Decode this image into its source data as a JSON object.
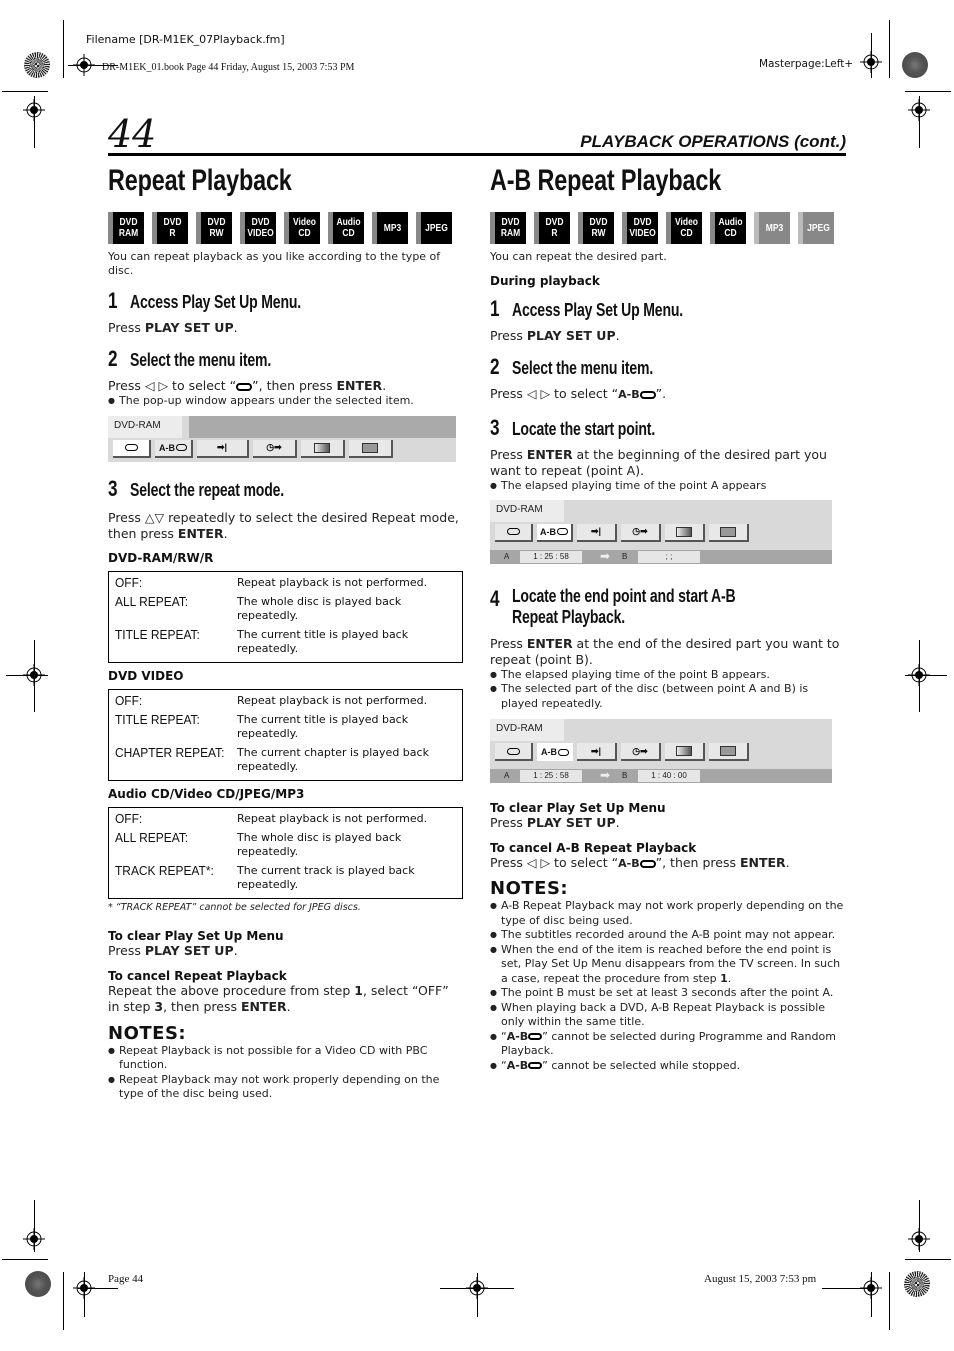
{
  "print_meta": {
    "filename": "Filename [DR-M1EK_07Playback.fm]",
    "book_line": "DR-M1EK_01.book  Page 44  Friday, August 15, 2003  7:53 PM",
    "masterpage": "Masterpage:Left+",
    "footer_page": "Page 44",
    "footer_date": "August 15, 2003 7:53 pm"
  },
  "page": {
    "number": "44",
    "section_header": "PLAYBACK OPERATIONS (cont.)"
  },
  "disc_types": [
    {
      "label": "DVD\nRAM"
    },
    {
      "label": "DVD\nR"
    },
    {
      "label": "DVD\nRW"
    },
    {
      "label": "DVD\nVIDEO"
    },
    {
      "label": "Video\nCD"
    },
    {
      "label": "Audio\nCD"
    },
    {
      "label": "MP3"
    },
    {
      "label": "JPEG"
    }
  ],
  "left": {
    "title": "Repeat Playback",
    "disc_support": [
      true,
      true,
      true,
      true,
      true,
      true,
      true,
      true
    ],
    "intro": "You can repeat playback as you like according to the type of disc.",
    "steps": [
      {
        "num": "1",
        "title": "Access Play Set Up Menu.",
        "text_pre": "Press ",
        "text_bold": "PLAY SET UP",
        "text_post": "."
      },
      {
        "num": "2",
        "title": "Select the menu item.",
        "text_pre": "Press ◁ ▷ to select “",
        "text_mid": "”, then press ",
        "text_bold": "ENTER",
        "text_post": ".",
        "bullet": "The pop-up window appears under the selected item."
      },
      {
        "num": "3",
        "title": "Select the repeat mode.",
        "text_pre": "Press △▽ repeatedly to select the desired Repeat mode, then press ",
        "text_bold": "ENTER",
        "text_post": "."
      }
    ],
    "osd": {
      "tab": "DVD-RAM",
      "ab_label": "A-B"
    },
    "tables": [
      {
        "heading": "DVD-RAM/RW/R",
        "rows": [
          {
            "k": "OFF:",
            "v": "Repeat playback is not performed."
          },
          {
            "k": "ALL REPEAT:",
            "v": "The whole disc is played back repeatedly."
          },
          {
            "k": "TITLE REPEAT:",
            "v": "The current title is played back repeatedly."
          }
        ]
      },
      {
        "heading": "DVD VIDEO",
        "rows": [
          {
            "k": "OFF:",
            "v": "Repeat playback is not performed."
          },
          {
            "k": "TITLE REPEAT:",
            "v": "The current title is played back repeatedly."
          },
          {
            "k": "CHAPTER REPEAT:",
            "v": "The current chapter is played back repeatedly."
          }
        ]
      },
      {
        "heading": "Audio CD/Video CD/JPEG/MP3",
        "rows": [
          {
            "k": "OFF:",
            "v": "Repeat playback is not performed."
          },
          {
            "k": "ALL REPEAT:",
            "v": "The whole disc is played back repeatedly."
          },
          {
            "k": "TRACK REPEAT*:",
            "v": "The current track is played back repeatedly."
          }
        ]
      }
    ],
    "footnote": "*  “TRACK REPEAT” cannot be selected for JPEG discs.",
    "clear": {
      "heading": "To clear Play Set Up Menu",
      "pre": "Press ",
      "bold": "PLAY SET UP",
      "post": "."
    },
    "cancel": {
      "heading": "To cancel Repeat Playback",
      "t1": "Repeat the above procedure from step ",
      "b1": "1",
      "t2": ", select “OFF” in step ",
      "b2": "3",
      "t3": ", then press ",
      "b3": "ENTER",
      "t4": "."
    },
    "notes_heading": "NOTES:",
    "notes": [
      "Repeat Playback is not possible for a Video CD with PBC function.",
      "Repeat Playback may not work properly depending on the type of the disc being used."
    ]
  },
  "right": {
    "title": "A-B Repeat Playback",
    "disc_support": [
      true,
      true,
      true,
      true,
      true,
      true,
      false,
      false
    ],
    "intro": "You can repeat the desired part.",
    "during": "During playback",
    "steps": [
      {
        "num": "1",
        "title": "Access Play Set Up Menu.",
        "text_pre": "Press ",
        "text_bold": "PLAY SET UP",
        "text_post": "."
      },
      {
        "num": "2",
        "title": "Select the menu item.",
        "text_pre": "Press ◁ ▷ to select “",
        "text_post": "”."
      },
      {
        "num": "3",
        "title": "Locate the start point.",
        "text_pre": "Press ",
        "text_bold": "ENTER",
        "text_post": " at the beginning of the desired part you want to repeat (point A).",
        "bullet": "The elapsed playing time of the point A appears"
      },
      {
        "num": "4",
        "title": "Locate the end point and start A-B Repeat Playback.",
        "text_pre": "Press ",
        "text_bold": "ENTER",
        "text_post": " at the end of the desired part you want to repeat (point B).",
        "bullets": [
          "The elapsed playing time of the point B appears.",
          "The selected part of the disc (between point A and B) is played repeatedly."
        ]
      }
    ],
    "osd1": {
      "tab": "DVD-RAM",
      "a_label": "A",
      "a_time": "1 : 25 : 58",
      "b_label": "B",
      "b_time": ";    ;"
    },
    "osd2": {
      "tab": "DVD-RAM",
      "a_label": "A",
      "a_time": "1 : 25 : 58",
      "b_label": "B",
      "b_time": "1 : 40 : 00"
    },
    "ab_label": "A-B",
    "clear": {
      "heading": "To clear Play Set Up Menu",
      "pre": "Press ",
      "bold": "PLAY SET UP",
      "post": "."
    },
    "cancel": {
      "heading": "To cancel A-B Repeat Playback",
      "pre": "Press ◁ ▷ to select “",
      "mid": "”, then press ",
      "bold": "ENTER",
      "post": "."
    },
    "notes_heading": "NOTES:",
    "notes": [
      {
        "text": "A-B Repeat Playback may not work properly depending on the type of disc being used."
      },
      {
        "text": "The subtitles recorded around the A-B point may not appear."
      },
      {
        "text_pre": "When the end of the item is reached before the end point is set, Play Set Up Menu disappears from the TV screen. In such a case, repeat the procedure from step ",
        "bold": "1",
        "text_post": "."
      },
      {
        "text": "The point B must be set at least 3 seconds after the point A."
      },
      {
        "text": "When playing back a DVD, A-B Repeat Playback is possible only within the same title."
      },
      {
        "text_post": "” cannot be selected during Programme and Random Playback."
      },
      {
        "text_post": "” cannot be selected while stopped."
      }
    ]
  }
}
